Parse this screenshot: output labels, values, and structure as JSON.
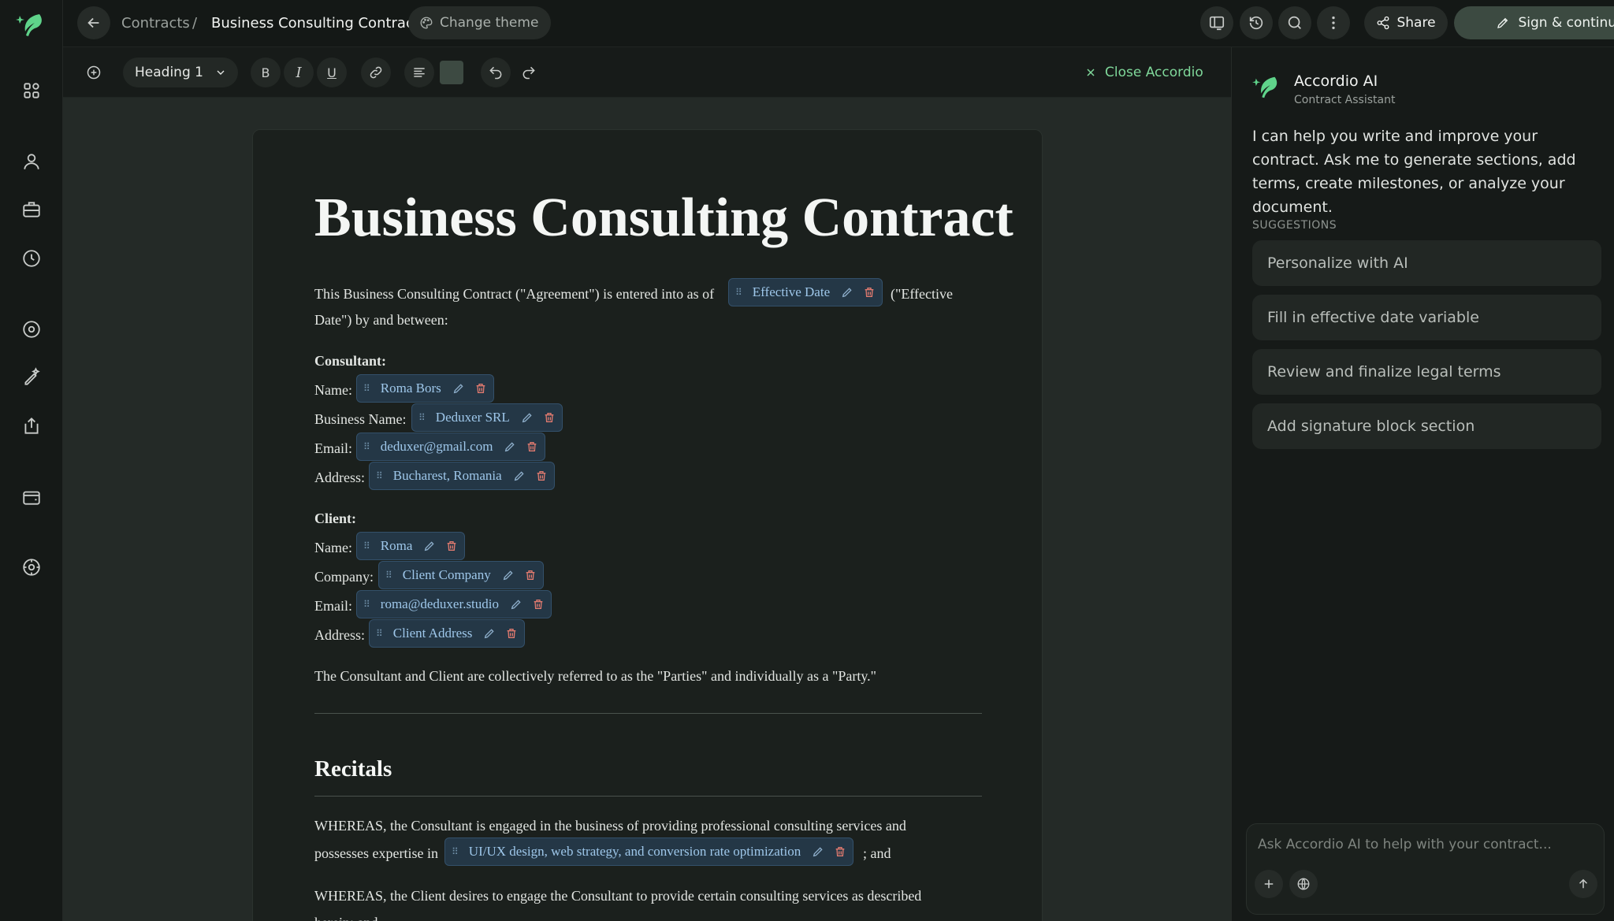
{
  "topbar": {
    "breadcrumb_root": "Contracts",
    "breadcrumb_sep": "/",
    "breadcrumb_current": "Business Consulting Contract",
    "change_theme_label": "Change theme",
    "share_label": "Share",
    "sign_label": "Sign & continue"
  },
  "toolbar": {
    "heading_value": "Heading 1",
    "bold": "B",
    "italic": "I",
    "underline": "U",
    "close_label": "Close Accordio"
  },
  "document": {
    "title": "Business Consulting Contract",
    "intro_before": "This Business Consulting Contract (\"Agreement\") is entered into as of",
    "intro_after": "(\"Effective",
    "intro_line2": "Date\") by and between:",
    "effective_date_var": "Effective Date",
    "consultant_heading": "Consultant:",
    "consultant": [
      {
        "label": "Name:",
        "value": "Roma Bors"
      },
      {
        "label": "Business Name:",
        "value": "Deduxer SRL"
      },
      {
        "label": "Email:",
        "value": "deduxer@gmail.com"
      },
      {
        "label": "Address:",
        "value": "Bucharest, Romania"
      }
    ],
    "client_heading": "Client:",
    "client": [
      {
        "label": "Name:",
        "value": "Roma"
      },
      {
        "label": "Company:",
        "value": "Client Company"
      },
      {
        "label": "Email:",
        "value": "roma@deduxer.studio"
      },
      {
        "label": "Address:",
        "value": "Client Address"
      }
    ],
    "parties_sentence": "The Consultant and Client are collectively referred to as the \"Parties\" and individually as a \"Party.\"",
    "recitals_heading": "Recitals",
    "whereas1_line1": "WHEREAS, the Consultant is engaged in the business of providing professional consulting services and",
    "whereas1_line2_before": "possesses expertise in",
    "expertise_var": "UI/UX design, web strategy, and conversion rate optimization",
    "whereas1_line2_after": "; and",
    "whereas2_line1": "WHEREAS, the Client desires to engage the Consultant to provide certain consulting services as described",
    "whereas2_line2": "herein; and"
  },
  "assistant": {
    "title": "Accordio AI",
    "subtitle": "Contract Assistant",
    "intro": "I can help you write and improve your contract. Ask me to generate sections, add terms, create milestones, or analyze your document.",
    "suggestions_heading": "SUGGESTIONS",
    "suggestions": [
      "Personalize with AI",
      "Fill in effective date variable",
      "Review and finalize legal terms",
      "Add signature block section"
    ],
    "input_placeholder": "Ask Accordio AI to help with your contract..."
  },
  "colors": {
    "accent_green": "#7fd89a",
    "variable_bg": "#243746",
    "variable_text": "#9ec7ea",
    "delete_red": "#e07a6f"
  },
  "icons": [
    "leaf-logo-icon",
    "apps-icon",
    "user-icon",
    "briefcase-icon",
    "clock-icon",
    "compass-icon",
    "pen-sparkle-icon",
    "export-icon",
    "wallet-icon",
    "settings-icon",
    "back-arrow-icon",
    "palette-icon",
    "layout-icon",
    "history-icon",
    "search-icon",
    "more-vertical-icon",
    "share-icon",
    "pen-icon",
    "add-circle-icon",
    "chevron-down-icon",
    "link-icon",
    "align-icon",
    "undo-icon",
    "redo-icon",
    "close-icon",
    "plus-icon",
    "globe-icon",
    "send-arrow-icon"
  ]
}
